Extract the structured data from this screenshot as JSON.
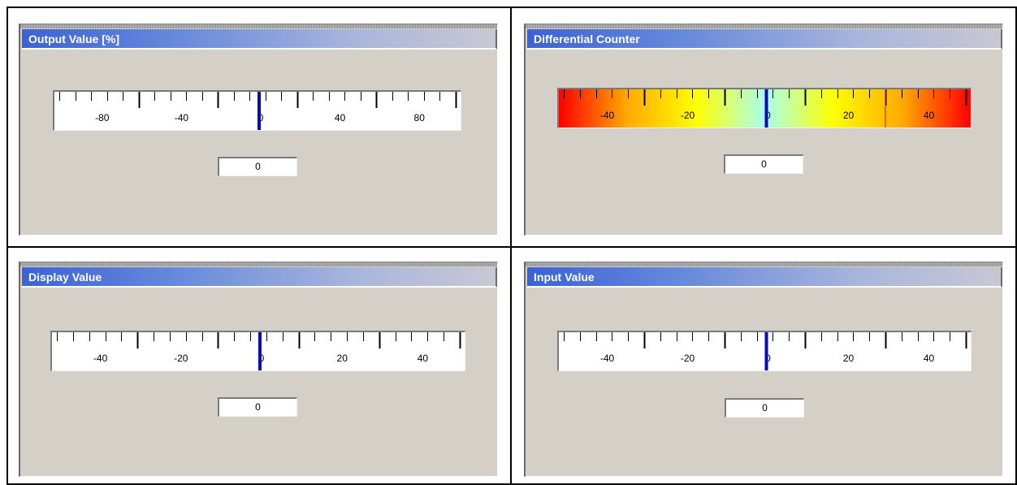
{
  "panels": [
    {
      "title": "Output Value [%]",
      "value": "0",
      "scale": {
        "min": -100,
        "max": 100,
        "minor_step": 8,
        "major_every": 5,
        "pointer": 0,
        "labels": [
          "-80",
          "-40",
          "0",
          "40",
          "80"
        ],
        "gradient": false
      }
    },
    {
      "title": "Differential Counter",
      "value": "0",
      "scale": {
        "min": -50,
        "max": 50,
        "minor_step": 4,
        "major_every": 5,
        "pointer": 0,
        "labels": [
          "-40",
          "-20",
          "0",
          "20",
          "40"
        ],
        "gradient": true,
        "marker": 30
      }
    },
    {
      "title": "Display Value",
      "value": "0",
      "scale": {
        "min": -50,
        "max": 50,
        "minor_step": 4,
        "major_every": 5,
        "pointer": 0,
        "labels": [
          "-40",
          "-20",
          "0",
          "20",
          "40"
        ],
        "gradient": false
      }
    },
    {
      "title": "Input Value",
      "value": "0",
      "scale": {
        "min": -50,
        "max": 50,
        "minor_step": 4,
        "major_every": 5,
        "pointer": 0,
        "labels": [
          "-40",
          "-20",
          "0",
          "20",
          "40"
        ],
        "gradient": false
      }
    }
  ],
  "colors": {
    "pointer": "#0a0ab4",
    "marker": "#d01010",
    "gradient": [
      "#ff0000",
      "#ffaa00",
      "#ffff00",
      "#aaffee",
      "#ffff00",
      "#ffaa00",
      "#ff0000"
    ]
  }
}
